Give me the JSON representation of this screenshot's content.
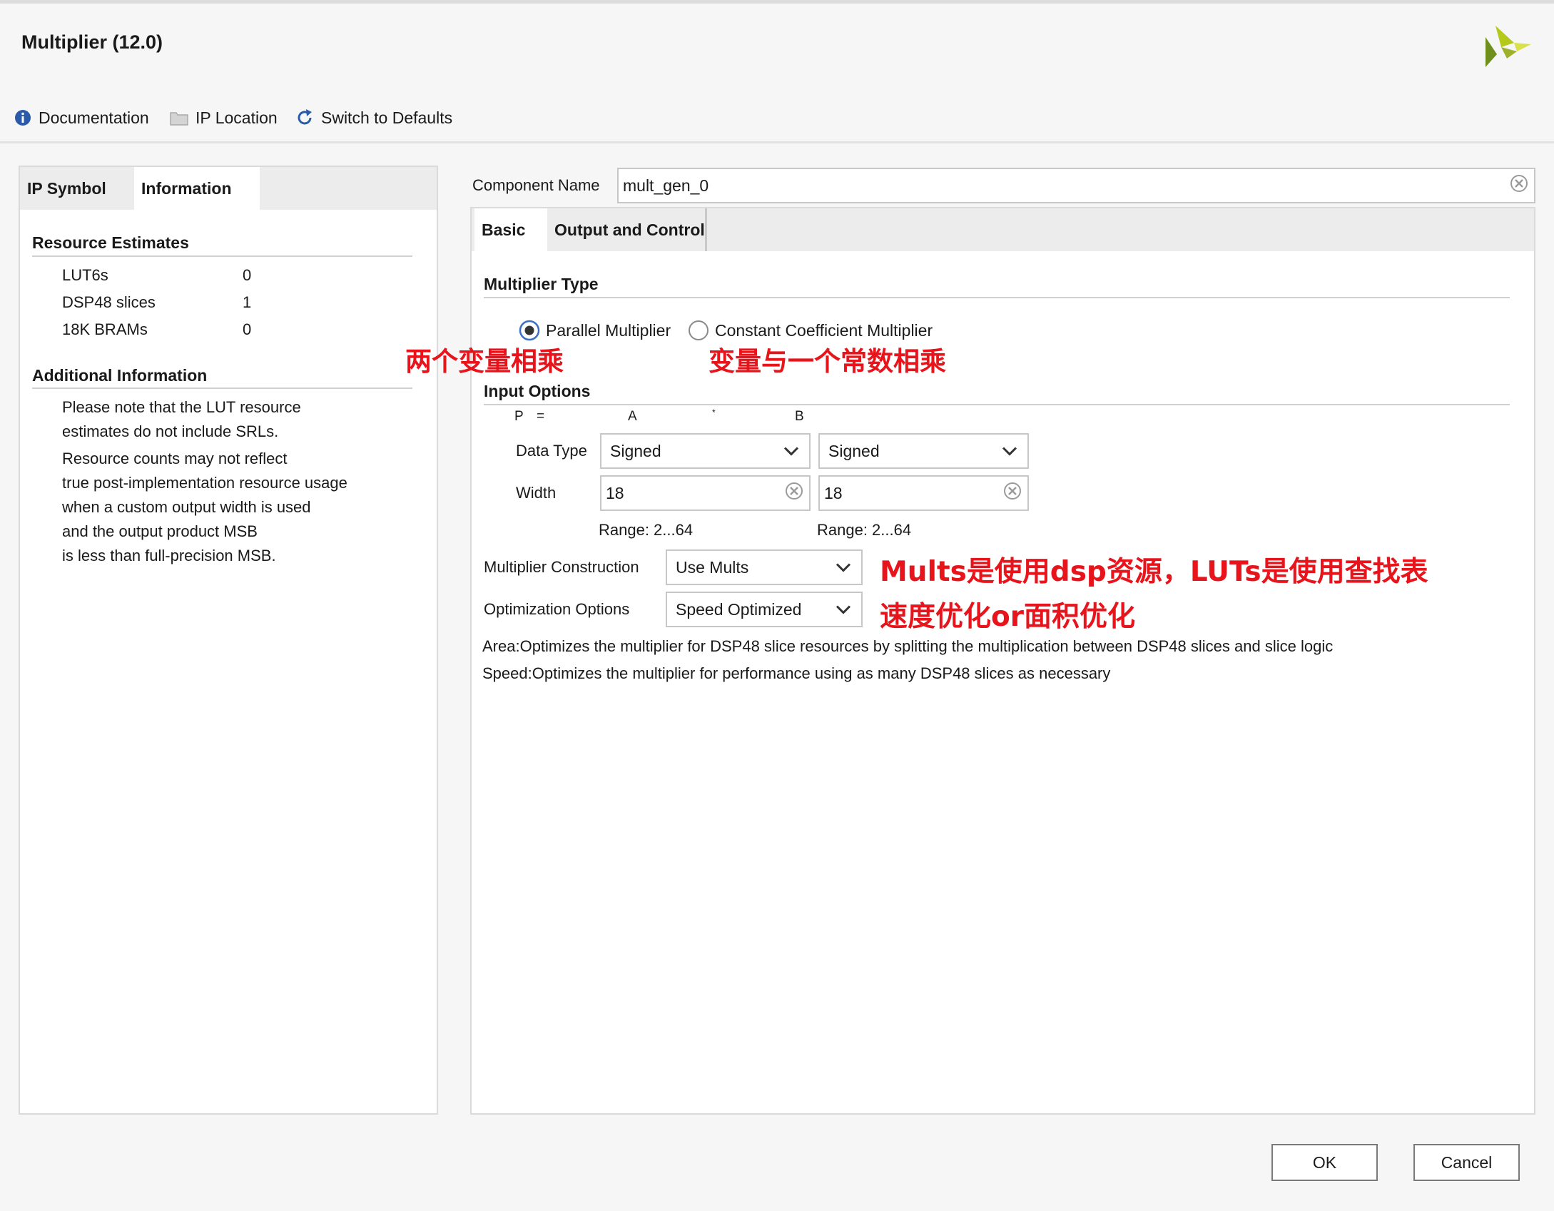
{
  "window": {
    "title": "Multiplier (12.0)"
  },
  "toolbar": {
    "documentation": "Documentation",
    "ip_location": "IP Location",
    "switch_defaults": "Switch to Defaults"
  },
  "left_tabs": {
    "ip_symbol": "IP Symbol",
    "information": "Information"
  },
  "resource": {
    "title": "Resource Estimates",
    "rows": [
      {
        "label": "LUT6s",
        "value": "0"
      },
      {
        "label": "DSP48 slices",
        "value": "1"
      },
      {
        "label": "18K BRAMs",
        "value": "0"
      }
    ]
  },
  "additional": {
    "title": "Additional Information",
    "lines": [
      "Please note that the LUT resource",
      "estimates do not include SRLs.",
      "Resource counts may not reflect",
      "true post-implementation resource usage",
      "when a custom output width is used",
      "and the output product MSB",
      "is less than full-precision MSB."
    ]
  },
  "component": {
    "label": "Component Name",
    "value": "mult_gen_0"
  },
  "right_tabs": {
    "basic": "Basic",
    "output_control": "Output and Control"
  },
  "multiplier_type": {
    "title": "Multiplier Type",
    "parallel": "Parallel Multiplier",
    "constant": "Constant Coefficient Multiplier",
    "selected": "parallel"
  },
  "input_options": {
    "title": "Input Options",
    "eq_p": "P",
    "eq_equals": "=",
    "eq_a": "A",
    "eq_times": "*",
    "eq_b": "B",
    "data_type_label": "Data Type",
    "data_type_a": "Signed",
    "data_type_b": "Signed",
    "width_label": "Width",
    "width_a": "18",
    "width_b": "18",
    "range_a": "Range: 2...64",
    "range_b": "Range: 2...64"
  },
  "construction": {
    "label": "Multiplier Construction",
    "value": "Use Mults"
  },
  "optimization": {
    "label": "Optimization Options",
    "value": "Speed Optimized"
  },
  "descriptions": {
    "area": "Area:Optimizes the multiplier for DSP48 slice resources by splitting the multiplication between DSP48 slices and slice logic",
    "speed": "Speed:Optimizes the multiplier for performance using as many DSP48 slices as necessary"
  },
  "annotations": {
    "two_vars": "两个变量相乘",
    "var_const": "变量与一个常数相乘",
    "mults_luts": "Mults是使用dsp资源，LUTs是使用查找表",
    "speed_area": "速度优化or面积优化"
  },
  "buttons": {
    "ok": "OK",
    "cancel": "Cancel"
  },
  "colors": {
    "annotation": "#e8141c",
    "radio_selected": "#3b6fc4"
  }
}
